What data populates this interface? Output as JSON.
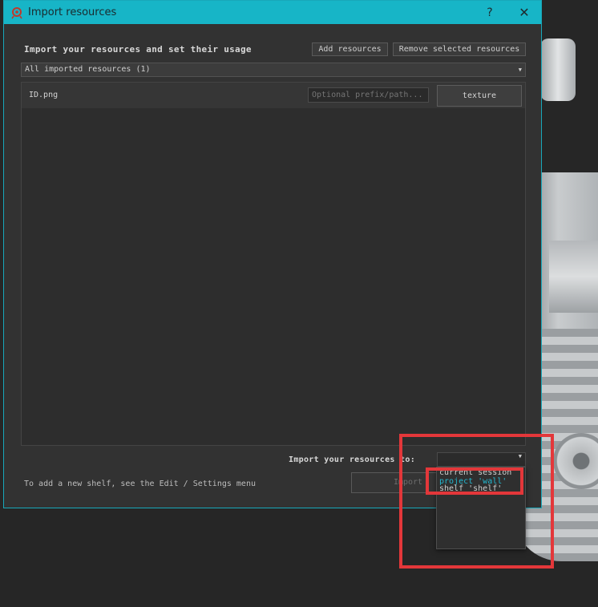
{
  "window": {
    "title": "Import resources",
    "help_label": "?",
    "close_label": "✕"
  },
  "toolbar": {
    "heading": "Import your resources and set their usage",
    "add_label": "Add resources",
    "remove_label": "Remove selected resources"
  },
  "filter": {
    "selected": "All imported resources (1)"
  },
  "resources": [
    {
      "name": "ID.png",
      "prefix_placeholder": "Optional prefix/path...",
      "usage": "texture"
    }
  ],
  "import_target": {
    "label": "Import your resources to:",
    "options": [
      "current session",
      "project 'wall'",
      "shelf 'shelf'"
    ],
    "highlighted_option": "project 'wall'"
  },
  "footer": {
    "hint": "To add a new shelf, see the Edit / Settings menu",
    "import_label": "Import"
  },
  "colors": {
    "title_bar": "#17b5c7",
    "accent": "#23b8d0",
    "annotation": "#e3373a"
  }
}
